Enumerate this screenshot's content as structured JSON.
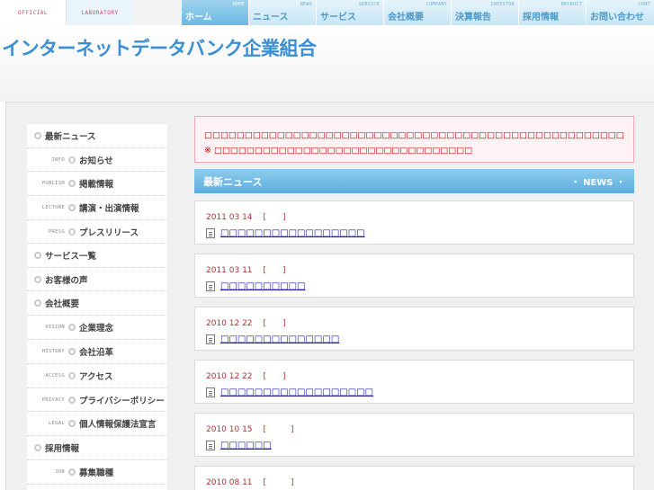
{
  "top_links": {
    "official": "OFFICIAL",
    "laboratory": "LABORATORY"
  },
  "nav": [
    {
      "en": "HOME",
      "jp": "ホーム",
      "active": true
    },
    {
      "en": "NEWS",
      "jp": "ニュース"
    },
    {
      "en": "SERVICE",
      "jp": "サービス"
    },
    {
      "en": "COMPANY",
      "jp": "会社概要"
    },
    {
      "en": "INVESTOR",
      "jp": "決算報告"
    },
    {
      "en": "RECRUIT",
      "jp": "採用情報"
    },
    {
      "en": "CONT",
      "jp": "お問い合わせ"
    }
  ],
  "logo": "インターネットデータバンク企業組合",
  "sidebar": {
    "items": [
      {
        "type": "top",
        "label": "最新ニュース"
      },
      {
        "type": "sub",
        "en": "INFO",
        "label": "お知らせ"
      },
      {
        "type": "sub",
        "en": "PUBLISH",
        "label": "掲載情報"
      },
      {
        "type": "sub",
        "en": "LECTURE",
        "label": "講演・出演情報"
      },
      {
        "type": "sub",
        "en": "PRESS",
        "label": "プレスリリース"
      },
      {
        "type": "top",
        "label": "サービス一覧"
      },
      {
        "type": "top",
        "label": "お客様の声"
      },
      {
        "type": "top",
        "label": "会社概要"
      },
      {
        "type": "sub",
        "en": "VISION",
        "label": "企業理念"
      },
      {
        "type": "sub",
        "en": "HISTORY",
        "label": "会社沿革"
      },
      {
        "type": "sub",
        "en": "ACCESS",
        "label": "アクセス"
      },
      {
        "type": "sub",
        "en": "PRIVACY",
        "label": "プライバシーポリシー"
      },
      {
        "type": "sub",
        "en": "LEGAL",
        "label": "個人情報保護法宣言"
      },
      {
        "type": "top",
        "label": "採用情報"
      },
      {
        "type": "sub",
        "en": "JOB",
        "label": "募集職種"
      }
    ]
  },
  "notice": {
    "line1": "□□□□□□□□□□□□□□□□□□□□□□□□□□□□□□□□□□□□□□□□□□□□□□□□□□□□□□□□□□□□□□□",
    "icon": "※",
    "line2": "□□□□□□□□□□□□□□□□□□□□□□□□□□□□□□□□"
  },
  "news_header": {
    "title": "最新ニュース",
    "en": "・ NEWS ・"
  },
  "news": [
    {
      "date": "2011 03 14",
      "tag": "[　　]",
      "text": "□□□□□□□□□□□□□□□□□"
    },
    {
      "date": "2011 03 11",
      "tag": "[　　]",
      "text": "□□□□□□□□□□"
    },
    {
      "date": "2010 12 22",
      "tag": "[　　]",
      "text": "□□□□□□□□□□□□□□"
    },
    {
      "date": "2010 12 22",
      "tag": "[　　]",
      "text": "□□□□□□□□□□□□□□□□□□"
    },
    {
      "date": "2010 10 15",
      "tag": "[　　　]",
      "text": "□□□□□□"
    },
    {
      "date": "2010 08 11",
      "tag": "[　　　]",
      "text": ""
    }
  ]
}
